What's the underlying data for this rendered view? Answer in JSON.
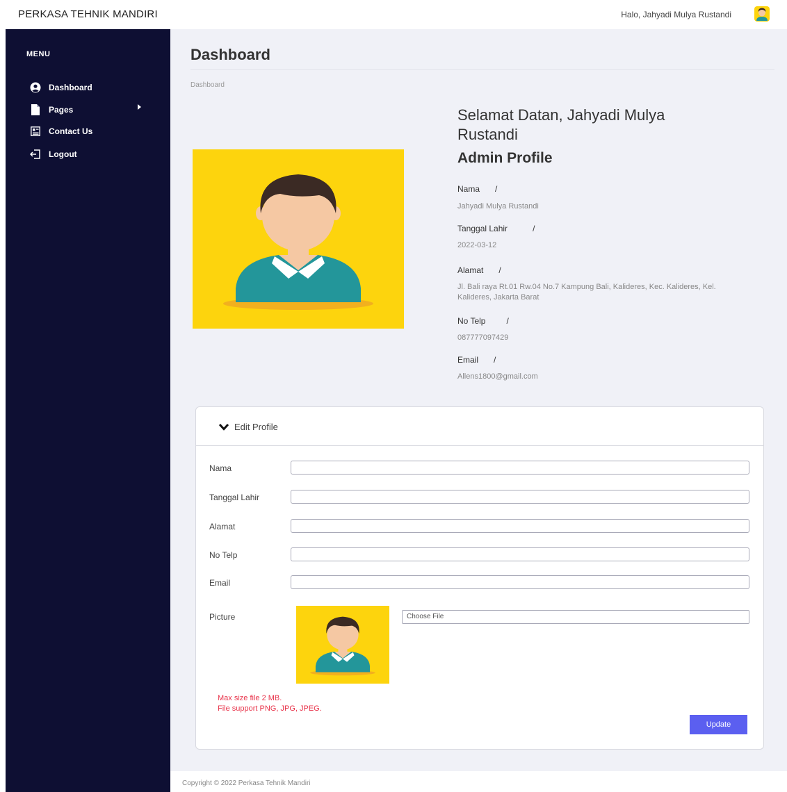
{
  "topbar": {
    "brand": "PERKASA TEHNIK MANDIRI",
    "greeting": "Halo, Jahyadi Mulya Rustandi",
    "avatar_icon": "user-avatar-icon"
  },
  "sidebar": {
    "menu_title": "MENU",
    "items": [
      {
        "label": "Dashboard",
        "icon": "user-circle-icon"
      },
      {
        "label": "Pages",
        "icon": "file-icon"
      },
      {
        "label": "Contact Us",
        "icon": "contact-card-icon"
      },
      {
        "label": "Logout",
        "icon": "logout-icon"
      }
    ]
  },
  "main": {
    "title": "Dashboard",
    "breadcrumb": "Dashboard",
    "welcome": "Selamat Datan, Jahyadi Mulya Rustandi",
    "profile_title": "Admin Profile",
    "fields": [
      {
        "label": "Nama",
        "sep": "/",
        "value": "Jahyadi Mulya Rustandi"
      },
      {
        "label": "Tanggal Lahir",
        "sep": "/",
        "value": "2022-03-12"
      },
      {
        "label": "Alamat",
        "sep": "/",
        "value": "Jl. Bali raya Rt.01 Rw.04 No.7 Kampung Bali, Kalideres, Kec. Kalideres, Kel. Kalideres, Jakarta Barat"
      },
      {
        "label": "No Telp",
        "sep": "/",
        "value": "087777097429"
      },
      {
        "label": "Email",
        "sep": "/",
        "value": "Allens1800@gmail.com"
      }
    ]
  },
  "edit_form": {
    "header": "Edit Profile",
    "labels": {
      "nama": "Nama",
      "tanggal_lahir": "Tanggal Lahir",
      "alamat": "Alamat",
      "no_telp": "No Telp",
      "email": "Email",
      "picture": "Picture"
    },
    "choose_file": "Choose File",
    "note_size": "Max size file 2 MB.",
    "note_types": "File support PNG, JPG, JPEG.",
    "update_label": "Update"
  },
  "footer": {
    "text": "Copyright © 2022 Perkasa Tehnik Mandiri"
  },
  "colors": {
    "sidebar_bg": "#0e0f33",
    "content_bg": "#f0f1f7",
    "avatar_bg": "#fdd40d",
    "shirt": "#23969a",
    "hair": "#3b2a24",
    "skin": "#f5c8a3",
    "button": "#5b5ff0",
    "note": "#e8334a"
  }
}
